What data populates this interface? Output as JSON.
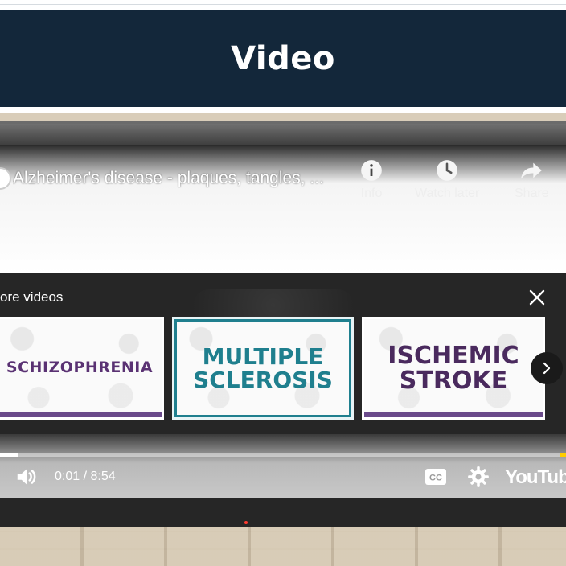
{
  "page": {
    "heading": "Video"
  },
  "player": {
    "video_title": "Alzheimer's disease - plaques, tangles, ...",
    "top_actions": [
      {
        "label": "Info",
        "icon": "info-icon"
      },
      {
        "label": "Watch later",
        "icon": "clock-icon"
      },
      {
        "label": "Share",
        "icon": "share-icon"
      }
    ],
    "more_videos": {
      "label": "ore videos",
      "items": [
        {
          "title": "SCHIZOPHRENIA",
          "frame_color": "#6a4a8a"
        },
        {
          "title": "MULTIPLE SCLEROSIS",
          "frame_color": "#1f7f8e"
        },
        {
          "title": "ISCHEMIC STROKE",
          "frame_color": "#6a4a8a"
        }
      ]
    },
    "controls": {
      "current_time": "0:01",
      "duration": "8:54",
      "time_display": "0:01 / 8:54",
      "progress_fraction": 0.002,
      "brand": "YouTube"
    }
  },
  "colors": {
    "header_bg": "#13273a",
    "accent_progress": "#ffcc00"
  }
}
